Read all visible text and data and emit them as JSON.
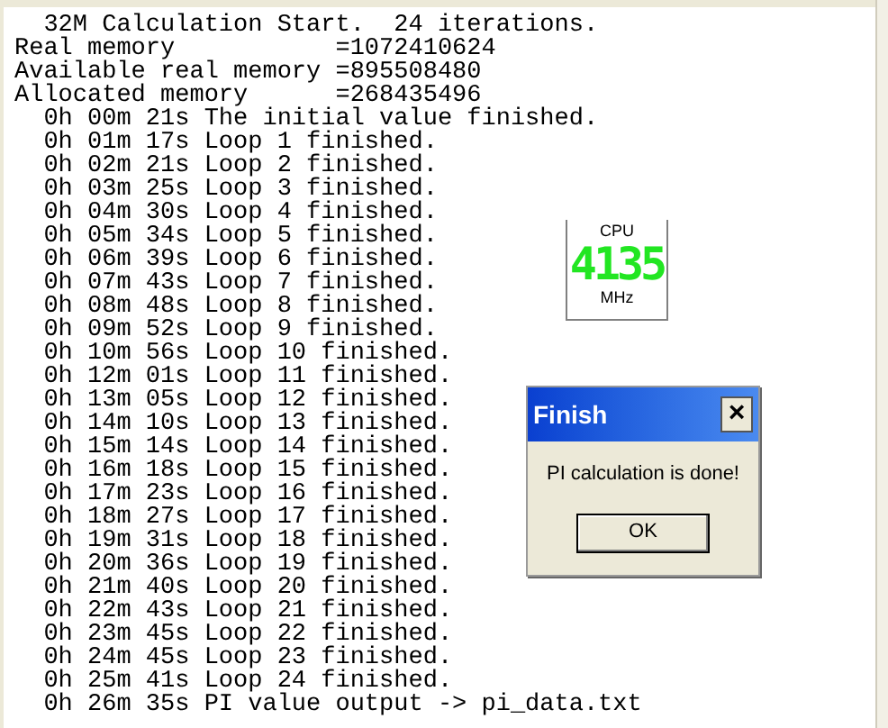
{
  "log_lines": [
    "  32M Calculation Start.  24 iterations.",
    "Real memory           =1072410624",
    "Available real memory =895508480",
    "Allocated memory      =268435496",
    "  0h 00m 21s The initial value finished.",
    "  0h 01m 17s Loop 1 finished.",
    "  0h 02m 21s Loop 2 finished.",
    "  0h 03m 25s Loop 3 finished.",
    "  0h 04m 30s Loop 4 finished.",
    "  0h 05m 34s Loop 5 finished.",
    "  0h 06m 39s Loop 6 finished.",
    "  0h 07m 43s Loop 7 finished.",
    "  0h 08m 48s Loop 8 finished.",
    "  0h 09m 52s Loop 9 finished.",
    "  0h 10m 56s Loop 10 finished.",
    "  0h 12m 01s Loop 11 finished.",
    "  0h 13m 05s Loop 12 finished.",
    "  0h 14m 10s Loop 13 finished.",
    "  0h 15m 14s Loop 14 finished.",
    "  0h 16m 18s Loop 15 finished.",
    "  0h 17m 23s Loop 16 finished.",
    "  0h 18m 27s Loop 17 finished.",
    "  0h 19m 31s Loop 18 finished.",
    "  0h 20m 36s Loop 19 finished.",
    "  0h 21m 40s Loop 20 finished.",
    "  0h 22m 43s Loop 21 finished.",
    "  0h 23m 45s Loop 22 finished.",
    "  0h 24m 45s Loop 23 finished.",
    "  0h 25m 41s Loop 24 finished.",
    "  0h 26m 35s PI value output -> pi_data.txt"
  ],
  "cpu_meter": {
    "label": "CPU",
    "value": "4135",
    "unit": "MHz"
  },
  "dialog": {
    "title": "Finish",
    "close": "×",
    "message": "PI calculation is done!",
    "button": "OK"
  }
}
